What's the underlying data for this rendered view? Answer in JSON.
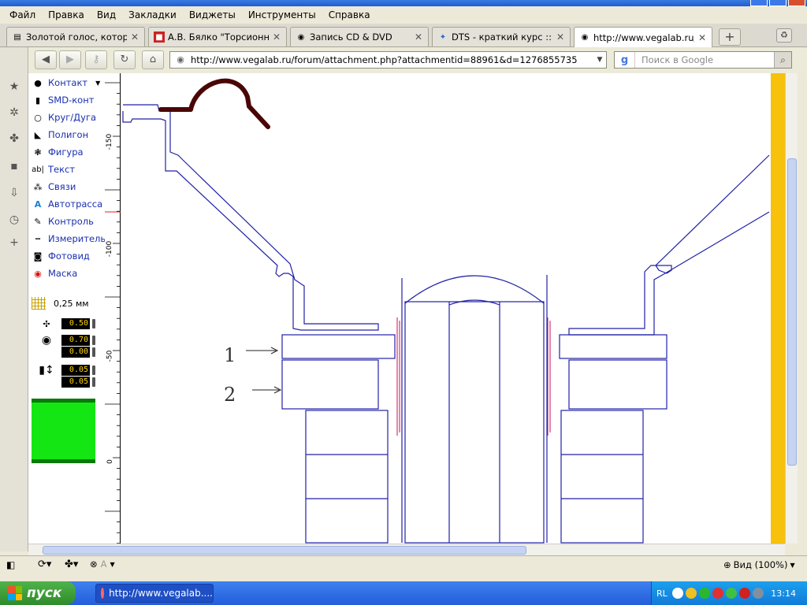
{
  "menu": [
    "Файл",
    "Правка",
    "Вид",
    "Закладки",
    "Виджеты",
    "Инструменты",
    "Справка"
  ],
  "tabs": [
    {
      "label": "Золотой голос, которы...",
      "active": false
    },
    {
      "label": "А.В. Бялко \"Торсионны...",
      "active": false
    },
    {
      "label": "Запись CD & DVD",
      "active": false
    },
    {
      "label": "DTS - краткий курс :: N...",
      "active": false
    },
    {
      "label": "http://www.vegalab.ru/...",
      "active": true
    }
  ],
  "address": {
    "url": "http://www.vegalab.ru/forum/attachment.php?attachmentid=88961&d=1276855735"
  },
  "search": {
    "placeholder": "Поиск в Google"
  },
  "tools": [
    {
      "label": "Контакт",
      "icon": "contact-icon"
    },
    {
      "label": "SMD-конт",
      "icon": "smd-icon"
    },
    {
      "label": "Круг/Дуга",
      "icon": "circle-icon"
    },
    {
      "label": "Полигон",
      "icon": "polygon-icon"
    },
    {
      "label": "Фигура",
      "icon": "shape-icon"
    },
    {
      "label": "Текст",
      "icon": "text-icon"
    },
    {
      "label": "Связи",
      "icon": "links-icon"
    },
    {
      "label": "Автотрасса",
      "icon": "autoroute-icon"
    },
    {
      "label": "Контроль",
      "icon": "control-icon"
    },
    {
      "label": "Измеритель",
      "icon": "measure-icon"
    },
    {
      "label": "Фотовид",
      "icon": "camera-icon"
    },
    {
      "label": "Маска",
      "icon": "mask-icon"
    }
  ],
  "grid": {
    "value": "0,25 мм"
  },
  "params": {
    "track": "0.50",
    "pad_outer": "0.70",
    "pad_inner": "0.00",
    "smd_w": "0.05",
    "smd_h": "0.05"
  },
  "layer_color": "#14e614",
  "ruler": {
    "labels": [
      "-150",
      "-100",
      "-50",
      "0"
    ]
  },
  "drawing": {
    "annotations": [
      "1",
      "2"
    ]
  },
  "status": {
    "zoom": "Вид (100%)",
    "a_label": "A"
  },
  "taskbar": {
    "start": "пуск",
    "item": "http://www.vegalab....",
    "lang": "RL",
    "clock": "13:14"
  }
}
